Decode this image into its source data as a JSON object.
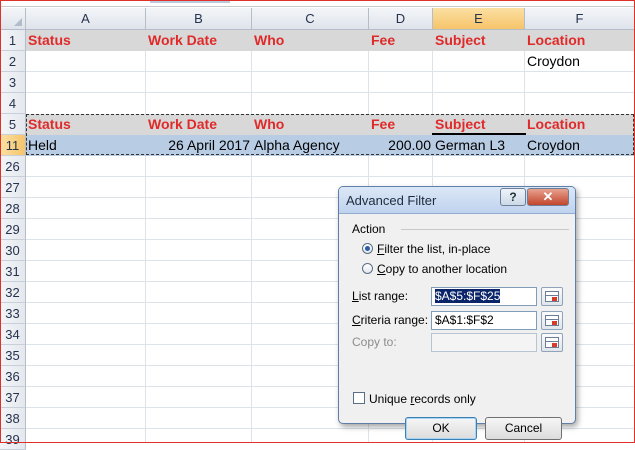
{
  "columns": [
    "A",
    "B",
    "C",
    "D",
    "E",
    "F"
  ],
  "selected_column": "E",
  "row_numbers": [
    "1",
    "2",
    "3",
    "4",
    "5",
    "11",
    "26",
    "27",
    "28",
    "29",
    "30",
    "31",
    "32",
    "33",
    "34",
    "35",
    "36",
    "37",
    "38",
    "39"
  ],
  "sheet": {
    "criteria_header": [
      "Status",
      "Work Date",
      "Who",
      "Fee",
      "Subject",
      "Location"
    ],
    "criteria_value": {
      "location": "Croydon"
    },
    "list_header": [
      "Status",
      "Work Date",
      "Who",
      "Fee",
      "Subject",
      "Location"
    ],
    "row_11": [
      "Held",
      "26 April 2017",
      "Alpha Agency",
      "200.00",
      "German L3",
      "Croydon"
    ]
  },
  "colors": {
    "header_text": "#e02a2a",
    "criteria_fill": "#d8d8d8",
    "selection_fill": "#b8cce4"
  },
  "dialog": {
    "title": "Advanced Filter",
    "help_label": "?",
    "close_label": "✕",
    "action_label": "Action",
    "option_inplace": "Filter the list, in-place",
    "option_copy": "Copy to another location",
    "selected_option": "inplace",
    "list_range_label": "List range:",
    "list_range_value": "$A$5:$F$25",
    "criteria_range_label": "Criteria range:",
    "criteria_range_value": "$A$1:$F$2",
    "copy_to_label": "Copy to:",
    "copy_to_value": "",
    "unique_label": "Unique records only",
    "unique_checked": false,
    "ok_label": "OK",
    "cancel_label": "Cancel"
  }
}
